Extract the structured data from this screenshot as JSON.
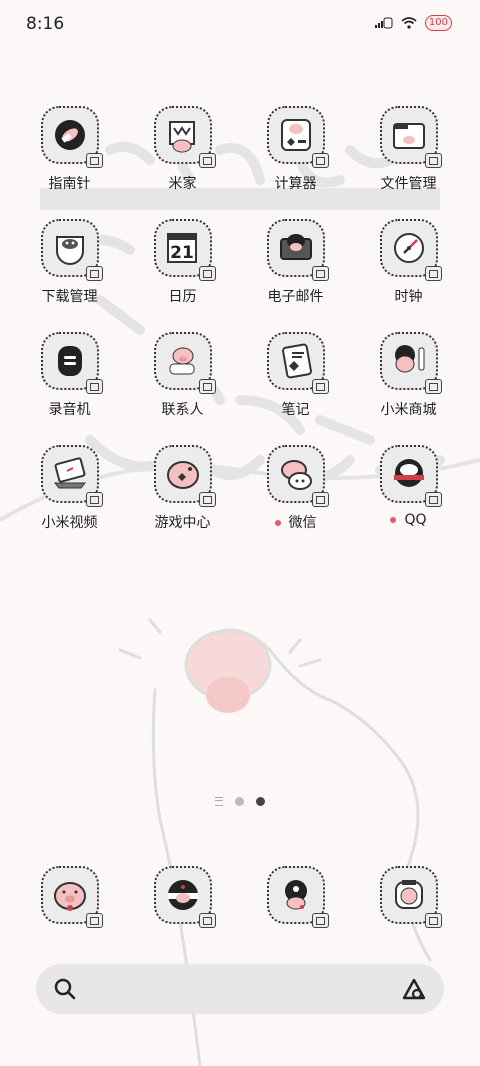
{
  "status_bar": {
    "time": "8:16",
    "battery": "100"
  },
  "apps": [
    {
      "id": "compass",
      "label": "指南针",
      "new": false
    },
    {
      "id": "mijia",
      "label": "米家",
      "new": false
    },
    {
      "id": "calculator",
      "label": "计算器",
      "new": false
    },
    {
      "id": "file-manager",
      "label": "文件管理",
      "new": false
    },
    {
      "id": "download-manager",
      "label": "下载管理",
      "new": false
    },
    {
      "id": "calendar",
      "label": "日历",
      "new": false
    },
    {
      "id": "email",
      "label": "电子邮件",
      "new": false
    },
    {
      "id": "clock",
      "label": "时钟",
      "new": false
    },
    {
      "id": "recorder",
      "label": "录音机",
      "new": false
    },
    {
      "id": "contacts",
      "label": "联系人",
      "new": false
    },
    {
      "id": "notes",
      "label": "笔记",
      "new": false
    },
    {
      "id": "mi-store",
      "label": "小米商城",
      "new": false
    },
    {
      "id": "mi-video",
      "label": "小米视频",
      "new": false
    },
    {
      "id": "game-center",
      "label": "游戏中心",
      "new": false
    },
    {
      "id": "wechat",
      "label": "微信",
      "new": true
    },
    {
      "id": "qq",
      "label": "QQ",
      "new": true
    }
  ],
  "calendar_date": "21",
  "dock": [
    "phone",
    "browser",
    "camera",
    "gallery"
  ],
  "pager": {
    "pages": 2,
    "active": 1
  },
  "colors": {
    "accent": "#e85a66",
    "pig": "#f4c1c0",
    "icon_bg": "#ececec"
  }
}
